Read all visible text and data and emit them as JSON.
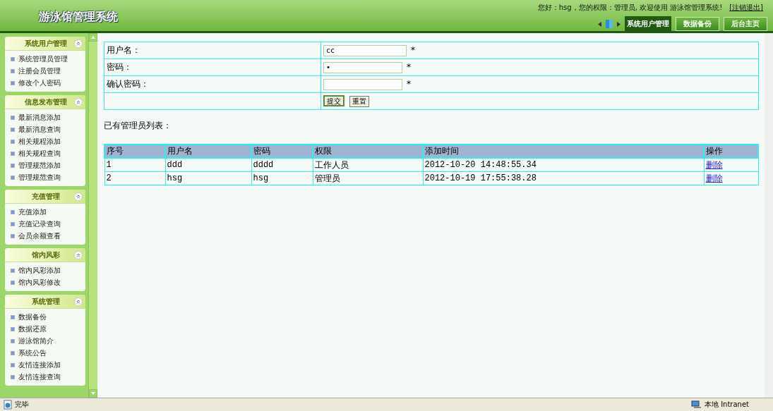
{
  "header": {
    "title": "游泳馆管理系统",
    "greeting": "您好：hsg，您的权限：管理员, 欢迎使用 游泳馆管理系统!",
    "logout": "[注销退出]",
    "tabs": [
      {
        "label": "系统用户管理",
        "selected": true
      },
      {
        "label": "数据备份",
        "selected": false
      },
      {
        "label": "后台主页",
        "selected": false
      }
    ]
  },
  "sidebar": {
    "sections": [
      {
        "title": "系统用户管理",
        "items": [
          "系统管理员管理",
          "注册会员管理",
          "修改个人密码"
        ]
      },
      {
        "title": "信息发布管理",
        "items": [
          "最新消息添加",
          "最新消息查询",
          "相关规程添加",
          "相关规程查询",
          "管理规范添加",
          "管理规范查询"
        ]
      },
      {
        "title": "充值管理",
        "items": [
          "充值添加",
          "充值记录查询",
          "会员余额查看"
        ]
      },
      {
        "title": "馆内风彩",
        "items": [
          "馆内风彩添加",
          "馆内风彩修改"
        ]
      },
      {
        "title": "系统管理",
        "items": [
          "数据备份",
          "数据还原",
          "游泳馆简介",
          "系统公告",
          "友情连接添加",
          "友情连接查询"
        ]
      }
    ]
  },
  "form": {
    "fields": [
      {
        "label": "用户名：",
        "value": "cc",
        "required": "*"
      },
      {
        "label": "密码：",
        "value": "•",
        "required": "*"
      },
      {
        "label": "确认密码：",
        "required": "*"
      }
    ],
    "buttons": [
      "提交",
      "重置"
    ]
  },
  "list_title": "已有管理员列表：",
  "table": {
    "columns": [
      "序号",
      "用户名",
      "密码",
      "权限",
      "添加时间",
      "操作"
    ],
    "rows": [
      [
        "1",
        "ddd",
        "dddd",
        "工作人员",
        "2012-10-20 14:48:55.34",
        "删除"
      ],
      [
        "2",
        "hsg",
        "hsg",
        "管理员",
        "2012-10-19 17:55:38.28",
        "删除"
      ]
    ]
  },
  "status_bar": {
    "text": "完毕",
    "zone": "本地 Intranet"
  }
}
